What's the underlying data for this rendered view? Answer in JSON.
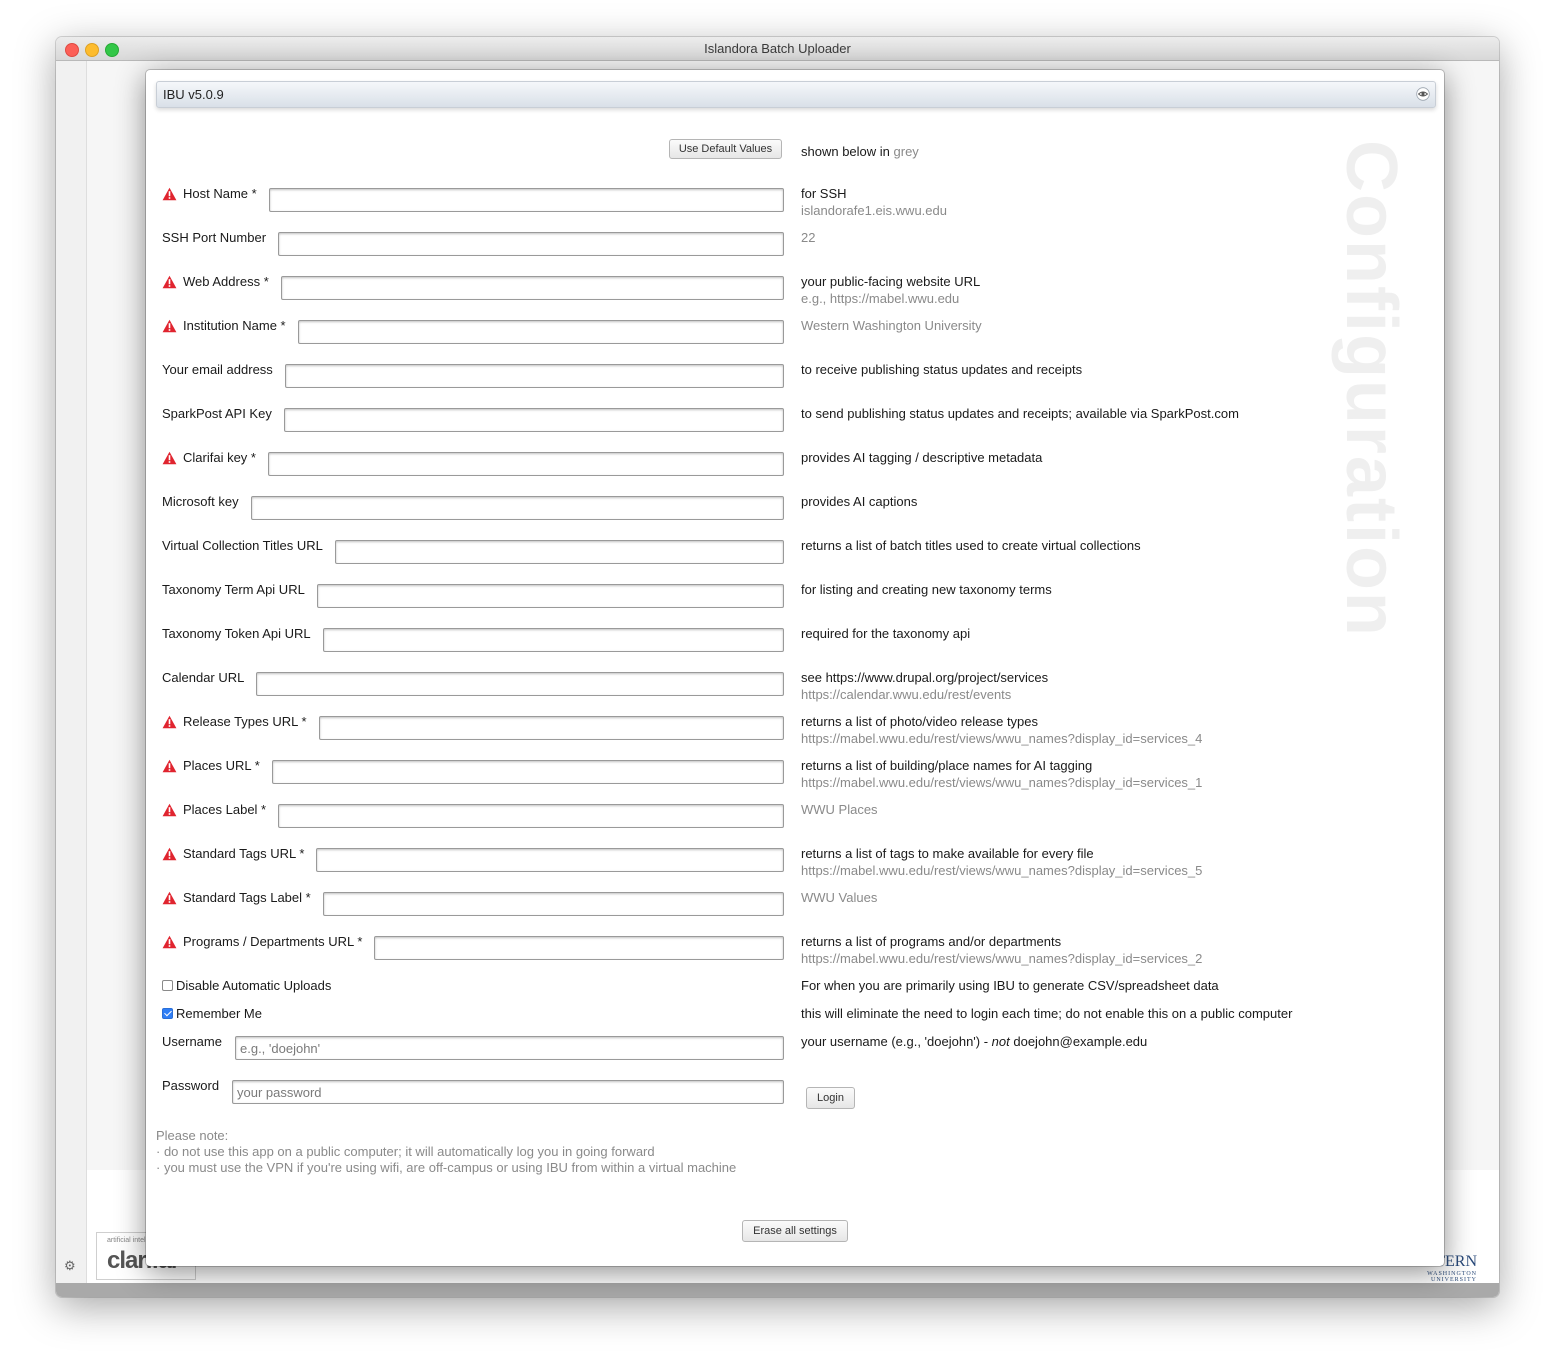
{
  "window": {
    "title": "Islandora Batch Uploader"
  },
  "panel": {
    "title": "IBU v5.0.9",
    "watermark": "Configuration",
    "default_button": "Use Default Values",
    "defaults_hint": "shown below in",
    "defaults_hint_grey": "grey"
  },
  "fields": [
    {
      "label": "Host Name *",
      "required": true,
      "desc": "for SSH",
      "sub": "islandorafe1.eis.wwu.edu"
    },
    {
      "label": "SSH Port Number",
      "required": false,
      "desc": "",
      "sub": "22"
    },
    {
      "label": "Web Address *",
      "required": true,
      "desc": "your public-facing website URL",
      "sub": "e.g., https://mabel.wwu.edu"
    },
    {
      "label": "Institution Name *",
      "required": true,
      "desc": "",
      "sub": "Western Washington University"
    },
    {
      "label": "Your email address",
      "required": false,
      "desc": "to receive publishing status updates and receipts",
      "sub": ""
    },
    {
      "label": "SparkPost API Key",
      "required": false,
      "desc": "to send publishing status updates and receipts; available via SparkPost.com",
      "sub": ""
    },
    {
      "label": "Clarifai key *",
      "required": true,
      "desc": "provides AI tagging / descriptive metadata",
      "sub": ""
    },
    {
      "label": "Microsoft key",
      "required": false,
      "desc": "provides AI captions",
      "sub": ""
    },
    {
      "label": "Virtual Collection Titles URL",
      "required": false,
      "desc": "returns a list of batch titles used to create virtual collections",
      "sub": ""
    },
    {
      "label": "Taxonomy Term Api URL",
      "required": false,
      "desc": "for listing and creating new taxonomy terms",
      "sub": ""
    },
    {
      "label": "Taxonomy Token Api URL",
      "required": false,
      "desc": "required for the taxonomy api",
      "sub": ""
    },
    {
      "label": "Calendar URL",
      "required": false,
      "desc": "see https://www.drupal.org/project/services",
      "sub": "https://calendar.wwu.edu/rest/events"
    },
    {
      "label": "Release Types URL *",
      "required": true,
      "desc": "returns a list of photo/video release types",
      "sub": "https://mabel.wwu.edu/rest/views/wwu_names?display_id=services_4"
    },
    {
      "label": "Places URL *",
      "required": true,
      "desc": "returns a list of building/place names for AI tagging",
      "sub": "https://mabel.wwu.edu/rest/views/wwu_names?display_id=services_1"
    },
    {
      "label": "Places Label *",
      "required": true,
      "desc": "",
      "sub": "WWU Places"
    },
    {
      "label": "Standard Tags URL *",
      "required": true,
      "desc": "returns a list of tags to make available for every file",
      "sub": "https://mabel.wwu.edu/rest/views/wwu_names?display_id=services_5"
    },
    {
      "label": "Standard Tags Label *",
      "required": true,
      "desc": "",
      "sub": "WWU Values"
    },
    {
      "label": "Programs / Departments URL *",
      "required": true,
      "desc": "returns a list of programs and/or departments",
      "sub": "https://mabel.wwu.edu/rest/views/wwu_names?display_id=services_2"
    }
  ],
  "checkboxes": {
    "disable_auto": {
      "label": "Disable Automatic Uploads",
      "checked": false,
      "desc": "For when you are primarily using IBU to generate CSV/spreadsheet data"
    },
    "remember_me": {
      "label": "Remember Me",
      "checked": true,
      "desc": "this will eliminate the need to login each time; do not enable this on a public computer"
    }
  },
  "login": {
    "username_label": "Username",
    "username_placeholder": "e.g., 'doejohn'",
    "username_desc_a": "your username (e.g., 'doejohn') - ",
    "username_desc_em": "not",
    "username_desc_b": " doejohn@example.edu",
    "password_label": "Password",
    "password_placeholder": "your password",
    "login_button": "Login"
  },
  "note": {
    "title": "Please note:",
    "line1": "· do not use this app on a public computer; it will automatically log you in going forward",
    "line2": "· you must use the VPN if you're using wifi, are off-campus or using IBU from within a virtual machine"
  },
  "erase_button": "Erase all settings",
  "background": {
    "clarifai_small": "artificial intel",
    "clarifai_big": "clarifai",
    "western_big": "WESTERN",
    "western_small": "WASHINGTON UNIVERSITY"
  },
  "colors": {
    "warning": "#e0242f",
    "checkbox_checked": "#2f7ef6",
    "hint_grey": "#8a8a8a"
  }
}
